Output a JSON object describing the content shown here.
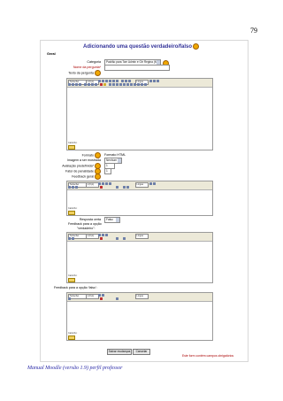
{
  "page_number": "79",
  "footer_text": "Manual Moodle (versão 1.9) perfil professor",
  "form": {
    "title": "Adicionando uma questão verdadeiro/falso",
    "section": "Geral",
    "category_label": "Categoria",
    "category_value": "Padrão para Tcm Admin e Gtr Regina (M",
    "question_name_label": "Nome da pergunta*",
    "question_text_label": "Texto da pergunta",
    "format_label": "Formato",
    "format_value": "Formato HTML",
    "image_label": "Imagem a ser mostrada",
    "image_value": "Nenhum",
    "default_grade_label": "Avaliação predefinida*",
    "default_grade_value": "1",
    "penalty_label": "Fator de penalidade",
    "penalty_value": "1",
    "general_feedback_label": "Feedback geral",
    "correct_answer_label": "Resposta certa",
    "correct_answer_value": "Falso",
    "feedback_true_label": "Feedback para a opção",
    "feedback_true_label2": "\"verdadeiro\":",
    "feedback_false_label": "Feedback para a opção 'falso':",
    "save_button": "Salvar mudanças",
    "cancel_button": "Cancelar",
    "required_note": "Este form contém campos obrigatórios"
  },
  "editor": {
    "font_value": "Trebuchet",
    "size_value": "1 (8 pt)",
    "heading_value": "Língua",
    "path_label": "Caminho:"
  },
  "colors": {
    "title": "#333399",
    "required": "#aa0000",
    "toolbar": "#ece9d8",
    "footer": "#2a2aa8"
  }
}
